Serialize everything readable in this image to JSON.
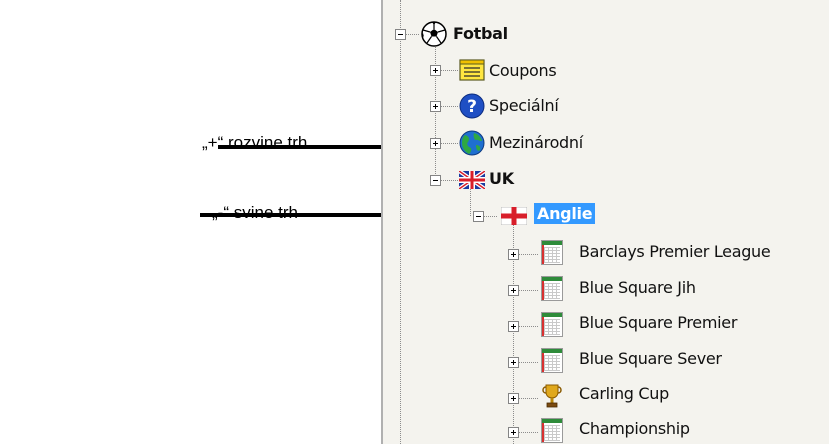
{
  "annotations": {
    "expand_note": "„+“ rozvine trh",
    "collapse_note": "„-“ svine trh"
  },
  "tree": {
    "root": {
      "label": "Fotbal",
      "icon": "soccer-ball-icon",
      "state": "expanded"
    },
    "level1": [
      {
        "label": "Coupons",
        "icon": "coupon-icon",
        "state": "collapsed"
      },
      {
        "label": "Speciální",
        "icon": "question-icon",
        "state": "collapsed"
      },
      {
        "label": "Mezinárodní",
        "icon": "globe-icon",
        "state": "collapsed"
      },
      {
        "label": "UK",
        "icon": "uk-flag-icon",
        "state": "expanded"
      }
    ],
    "selected": {
      "label": "Anglie",
      "icon": "england-flag-icon",
      "state": "expanded"
    },
    "leagues": [
      {
        "label": "Barclays Premier League",
        "icon": "league-table-icon"
      },
      {
        "label": "Blue Square Jih",
        "icon": "league-table-icon"
      },
      {
        "label": "Blue Square Premier",
        "icon": "league-table-icon"
      },
      {
        "label": "Blue Square Sever",
        "icon": "league-table-icon"
      },
      {
        "label": "Carling Cup",
        "icon": "trophy-icon"
      },
      {
        "label": "Championship",
        "icon": "league-table-icon"
      }
    ]
  },
  "colors": {
    "selection": "#3399ff",
    "panel_background": "#f4f3ee"
  }
}
